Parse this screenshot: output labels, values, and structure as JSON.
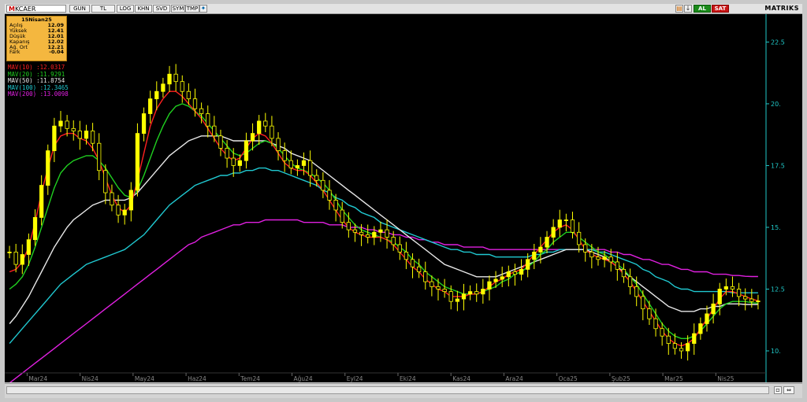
{
  "toolbar": {
    "symbol": "KCAER",
    "symbol_prefix": "M",
    "buttons": [
      "GUN",
      "TL",
      "LOG",
      "KHN",
      "SVD",
      "SYM",
      "TMP"
    ],
    "buy_label": "AL",
    "sell_label": "SAT",
    "brand": "MATRIKS"
  },
  "info_box": {
    "date": "15Nisan25",
    "rows": [
      {
        "label": "Açılış",
        "value": "12.09"
      },
      {
        "label": "Yüksek",
        "value": "12.41"
      },
      {
        "label": "Düşük",
        "value": "12.01"
      },
      {
        "label": "Kapanış",
        "value": "12.02"
      },
      {
        "label": "Ağ. Ort",
        "value": "12.21"
      },
      {
        "label": "Fark",
        "value": "-0.04"
      }
    ]
  },
  "colors": {
    "background": "#000000",
    "candle": "#ffff00",
    "mav10": "#ff2020",
    "mav20": "#20d020",
    "mav50": "#e8e8e8",
    "mav100": "#20c8d0",
    "mav200": "#e020e0",
    "axis": "#20c8c8"
  },
  "chart_data": {
    "type": "line",
    "subtype": "candlestick-with-moving-averages",
    "x_labels": [
      "Mar24",
      "Nis24",
      "May24",
      "Haz24",
      "Tem24",
      "Ağu24",
      "Eyl24",
      "Eki24",
      "Kas24",
      "Ara24",
      "Oca25",
      "Şub25",
      "Mar25",
      "Nis25"
    ],
    "y_ticks": [
      "10.",
      "12.5",
      "15.",
      "17.5",
      "20.",
      "22.5"
    ],
    "y_tick_values": [
      10,
      12.5,
      15,
      17.5,
      20,
      22.5
    ],
    "ylim": [
      9.3,
      23.5
    ],
    "price_close": [
      14.0,
      13.5,
      13.9,
      14.5,
      15.4,
      16.7,
      18.1,
      19.1,
      19.3,
      19.0,
      18.9,
      18.6,
      18.9,
      18.4,
      17.3,
      16.4,
      15.9,
      15.5,
      15.7,
      16.5,
      18.8,
      19.6,
      20.2,
      20.5,
      20.8,
      21.2,
      20.9,
      20.5,
      20.2,
      19.8,
      19.6,
      19.1,
      18.7,
      18.2,
      17.8,
      17.5,
      17.7,
      18.5,
      18.8,
      19.3,
      19.1,
      18.6,
      18.1,
      17.7,
      17.4,
      17.5,
      17.7,
      17.1,
      16.9,
      16.5,
      16.1,
      15.7,
      15.2,
      14.9,
      14.8,
      14.7,
      14.6,
      14.8,
      14.9,
      14.6,
      14.3,
      14.0,
      13.7,
      13.4,
      13.2,
      12.8,
      12.6,
      12.5,
      12.4,
      12.0,
      12.1,
      12.3,
      12.4,
      12.3,
      12.5,
      12.8,
      12.9,
      13.0,
      13.2,
      13.1,
      13.3,
      13.7,
      14.0,
      14.2,
      14.6,
      15.0,
      15.3,
      15.3,
      14.8,
      14.3,
      14.0,
      13.8,
      13.7,
      13.8,
      13.6,
      13.3,
      13.0,
      12.6,
      12.2,
      11.7,
      11.3,
      10.9,
      10.6,
      10.3,
      10.1,
      10.0,
      10.3,
      10.7,
      11.1,
      11.5,
      11.9,
      12.5,
      12.6,
      12.5,
      12.2,
      12.1,
      12.0,
      12.02
    ],
    "series": [
      {
        "name": "MAV(10)",
        "last_value": "12.0317",
        "values": [
          13.2,
          13.3,
          13.6,
          14.2,
          15.2,
          16.4,
          17.4,
          18.3,
          18.7,
          18.8,
          18.8,
          18.6,
          18.5,
          18.2,
          17.7,
          17.0,
          16.3,
          15.8,
          15.6,
          15.9,
          16.9,
          18.0,
          19.1,
          19.8,
          20.2,
          20.5,
          20.5,
          20.3,
          20.0,
          19.7,
          19.4,
          19.0,
          18.6,
          18.2,
          17.9,
          17.7,
          17.8,
          18.2,
          18.6,
          18.8,
          18.7,
          18.4,
          18.0,
          17.6,
          17.4,
          17.3,
          17.3,
          17.1,
          16.8,
          16.5,
          16.1,
          15.7,
          15.3,
          15.0,
          14.8,
          14.7,
          14.6,
          14.6,
          14.6,
          14.5,
          14.3,
          14.0,
          13.7,
          13.4,
          13.2,
          12.9,
          12.7,
          12.5,
          12.4,
          12.2,
          12.2,
          12.2,
          12.3,
          12.3,
          12.4,
          12.6,
          12.8,
          12.9,
          13.1,
          13.2,
          13.3,
          13.6,
          13.9,
          14.2,
          14.5,
          14.8,
          15.0,
          15.1,
          14.9,
          14.5,
          14.1,
          13.9,
          13.8,
          13.7,
          13.6,
          13.4,
          13.1,
          12.8,
          12.4,
          12.0,
          11.6,
          11.2,
          10.8,
          10.5,
          10.3,
          10.2,
          10.3,
          10.5,
          10.9,
          11.3,
          11.7,
          12.1,
          12.4,
          12.4,
          12.3,
          12.2,
          12.1,
          12.03
        ]
      },
      {
        "name": "MAV(20)",
        "last_value": "11.9291",
        "values": [
          12.5,
          12.7,
          13.0,
          13.5,
          14.2,
          15.0,
          15.8,
          16.6,
          17.2,
          17.5,
          17.7,
          17.8,
          17.9,
          17.9,
          17.7,
          17.4,
          17.0,
          16.6,
          16.3,
          16.2,
          16.5,
          17.1,
          17.8,
          18.5,
          19.1,
          19.6,
          19.9,
          20.0,
          19.9,
          19.7,
          19.5,
          19.2,
          18.9,
          18.6,
          18.3,
          18.0,
          17.9,
          18.0,
          18.2,
          18.4,
          18.5,
          18.4,
          18.2,
          17.9,
          17.6,
          17.4,
          17.3,
          17.2,
          17.0,
          16.8,
          16.5,
          16.1,
          15.7,
          15.4,
          15.1,
          14.9,
          14.8,
          14.7,
          14.6,
          14.5,
          14.4,
          14.2,
          14.0,
          13.7,
          13.5,
          13.2,
          13.0,
          12.8,
          12.6,
          12.5,
          12.4,
          12.3,
          12.3,
          12.3,
          12.4,
          12.5,
          12.6,
          12.8,
          12.9,
          13.1,
          13.2,
          13.4,
          13.6,
          13.9,
          14.1,
          14.4,
          14.6,
          14.8,
          14.8,
          14.6,
          14.4,
          14.2,
          14.0,
          13.9,
          13.7,
          13.5,
          13.3,
          13.0,
          12.7,
          12.3,
          11.9,
          11.5,
          11.1,
          10.8,
          10.6,
          10.5,
          10.5,
          10.6,
          10.8,
          11.1,
          11.4,
          11.7,
          11.9,
          12.0,
          12.0,
          12.0,
          11.95,
          11.93
        ]
      },
      {
        "name": "MAV(50)",
        "last_value": "11.8754",
        "values": [
          11.1,
          11.4,
          11.8,
          12.2,
          12.7,
          13.2,
          13.7,
          14.2,
          14.6,
          15.0,
          15.3,
          15.5,
          15.7,
          15.9,
          16.0,
          16.1,
          16.1,
          16.1,
          16.1,
          16.2,
          16.4,
          16.7,
          17.0,
          17.3,
          17.6,
          17.9,
          18.1,
          18.3,
          18.5,
          18.6,
          18.7,
          18.7,
          18.7,
          18.7,
          18.6,
          18.5,
          18.5,
          18.5,
          18.5,
          18.5,
          18.5,
          18.4,
          18.3,
          18.2,
          18.0,
          17.9,
          17.8,
          17.7,
          17.5,
          17.3,
          17.1,
          16.9,
          16.7,
          16.5,
          16.3,
          16.1,
          15.9,
          15.7,
          15.5,
          15.3,
          15.1,
          14.9,
          14.7,
          14.5,
          14.3,
          14.1,
          13.9,
          13.7,
          13.5,
          13.4,
          13.3,
          13.2,
          13.1,
          13.0,
          13.0,
          13.0,
          13.0,
          13.1,
          13.2,
          13.3,
          13.4,
          13.5,
          13.6,
          13.7,
          13.8,
          13.9,
          14.0,
          14.1,
          14.1,
          14.1,
          14.1,
          14.0,
          13.9,
          13.8,
          13.6,
          13.4,
          13.2,
          13.0,
          12.8,
          12.6,
          12.4,
          12.2,
          12.0,
          11.8,
          11.7,
          11.6,
          11.6,
          11.6,
          11.7,
          11.7,
          11.8,
          11.8,
          11.9,
          11.9,
          11.9,
          11.88,
          11.88,
          11.88
        ]
      },
      {
        "name": "MAV(100)",
        "last_value": "12.3465",
        "values": [
          10.3,
          10.6,
          10.9,
          11.2,
          11.5,
          11.8,
          12.1,
          12.4,
          12.7,
          12.9,
          13.1,
          13.3,
          13.5,
          13.6,
          13.7,
          13.8,
          13.9,
          14.0,
          14.1,
          14.3,
          14.5,
          14.7,
          15.0,
          15.3,
          15.6,
          15.9,
          16.1,
          16.3,
          16.5,
          16.7,
          16.8,
          16.9,
          17.0,
          17.1,
          17.1,
          17.2,
          17.2,
          17.3,
          17.3,
          17.4,
          17.4,
          17.3,
          17.3,
          17.2,
          17.1,
          17.0,
          16.9,
          16.8,
          16.7,
          16.5,
          16.4,
          16.2,
          16.1,
          15.9,
          15.8,
          15.6,
          15.5,
          15.4,
          15.2,
          15.1,
          15.0,
          14.9,
          14.8,
          14.7,
          14.6,
          14.5,
          14.4,
          14.3,
          14.2,
          14.1,
          14.1,
          14.0,
          14.0,
          13.9,
          13.9,
          13.9,
          13.8,
          13.8,
          13.8,
          13.8,
          13.8,
          13.8,
          13.9,
          13.9,
          14.0,
          14.0,
          14.1,
          14.1,
          14.1,
          14.1,
          14.1,
          14.1,
          14.0,
          14.0,
          13.9,
          13.8,
          13.7,
          13.6,
          13.5,
          13.3,
          13.2,
          13.0,
          12.9,
          12.8,
          12.6,
          12.5,
          12.5,
          12.4,
          12.4,
          12.4,
          12.4,
          12.4,
          12.4,
          12.35,
          12.35,
          12.35,
          12.35,
          12.35
        ]
      },
      {
        "name": "MAV(200)",
        "last_value": "13.0098",
        "values": [
          8.7,
          8.9,
          9.1,
          9.3,
          9.5,
          9.7,
          9.9,
          10.1,
          10.3,
          10.5,
          10.7,
          10.9,
          11.1,
          11.3,
          11.5,
          11.7,
          11.9,
          12.1,
          12.3,
          12.5,
          12.7,
          12.9,
          13.1,
          13.3,
          13.5,
          13.7,
          13.9,
          14.1,
          14.3,
          14.4,
          14.6,
          14.7,
          14.8,
          14.9,
          15.0,
          15.1,
          15.1,
          15.2,
          15.2,
          15.2,
          15.3,
          15.3,
          15.3,
          15.3,
          15.3,
          15.3,
          15.2,
          15.2,
          15.2,
          15.2,
          15.1,
          15.1,
          15.1,
          15.0,
          15.0,
          15.0,
          14.9,
          14.9,
          14.8,
          14.8,
          14.7,
          14.7,
          14.6,
          14.6,
          14.5,
          14.5,
          14.4,
          14.4,
          14.3,
          14.3,
          14.3,
          14.2,
          14.2,
          14.2,
          14.2,
          14.1,
          14.1,
          14.1,
          14.1,
          14.1,
          14.1,
          14.1,
          14.1,
          14.1,
          14.1,
          14.1,
          14.1,
          14.1,
          14.1,
          14.1,
          14.1,
          14.1,
          14.1,
          14.1,
          14.0,
          14.0,
          13.9,
          13.9,
          13.8,
          13.7,
          13.7,
          13.6,
          13.5,
          13.5,
          13.4,
          13.3,
          13.3,
          13.2,
          13.2,
          13.2,
          13.1,
          13.1,
          13.1,
          13.05,
          13.05,
          13.02,
          13.01,
          13.01
        ]
      }
    ]
  }
}
